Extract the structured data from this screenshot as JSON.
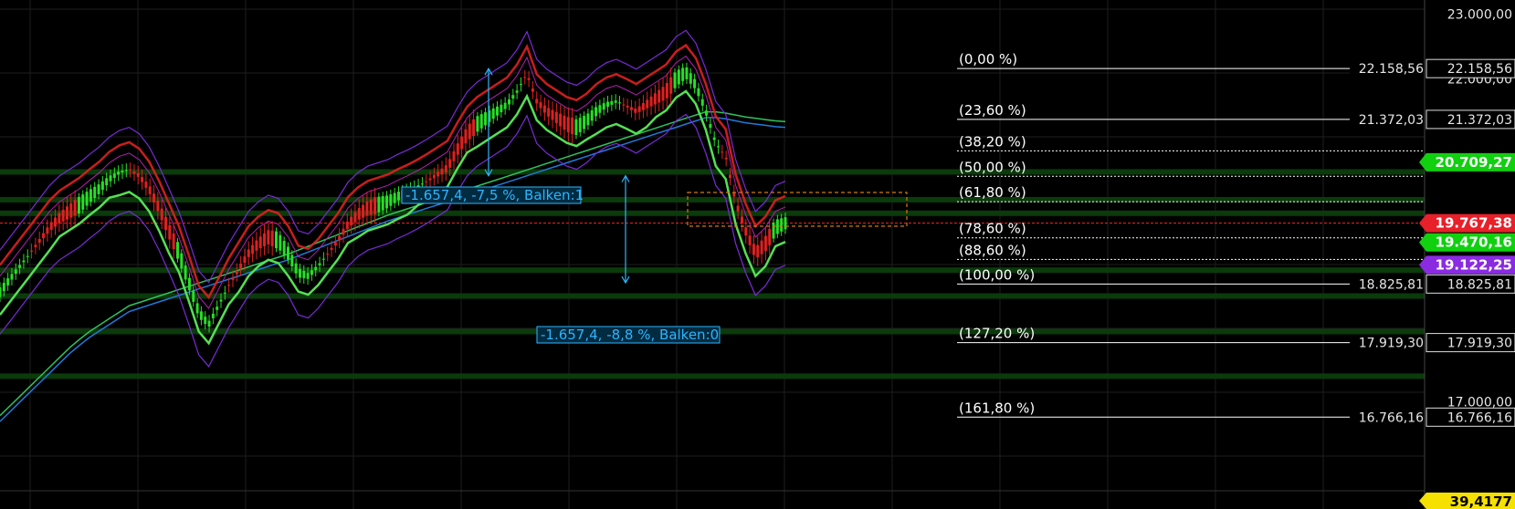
{
  "chart_data": {
    "type": "candlestick",
    "title": "",
    "ylim": [
      16700,
      23050
    ],
    "grid": true,
    "y_tick_labels": [
      "23.000,00",
      "22.000,00",
      "17.000,00"
    ],
    "fib_levels": [
      {
        "label": "(0,00 %)",
        "price_label": "22.158,56",
        "value": 22158.56
      },
      {
        "label": "(23,60 %)",
        "price_label": "21.372,03",
        "value": 21372.03
      },
      {
        "label": "(38,20 %)",
        "price_label": "",
        "value": 20885
      },
      {
        "label": "(50,00 %)",
        "price_label": "",
        "value": 20492
      },
      {
        "label": "(61,80 %)",
        "price_label": "",
        "value": 20099
      },
      {
        "label": "(78,60 %)",
        "price_label": "",
        "value": 19540
      },
      {
        "label": "(88,60 %)",
        "price_label": "",
        "value": 19207
      },
      {
        "label": "(100,00 %)",
        "price_label": "18.825,81",
        "value": 18825.81
      },
      {
        "label": "(127,20 %)",
        "price_label": "17.919,30",
        "value": 17919.3
      },
      {
        "label": "(161,80 %)",
        "price_label": "16.766,16",
        "value": 16766.16
      }
    ],
    "badges": [
      {
        "text": "20.709,27",
        "value": 20709.27,
        "color": "#10d010",
        "text_color": "#ffffff"
      },
      {
        "text": "19.767,38",
        "value": 19767.38,
        "color": "#e8202a",
        "text_color": "#ffffff"
      },
      {
        "text": "19.470,16",
        "value": 19470.16,
        "color": "#10d010",
        "text_color": "#ffffff"
      },
      {
        "text": "19.122,25",
        "value": 19122.25,
        "color": "#8a2be2",
        "text_color": "#ffffff"
      }
    ],
    "bottom_badge": {
      "text": "39,4177",
      "color": "#f5e000"
    },
    "measurements": [
      {
        "text": "-1.657,4, -7,5 %, Balken:1",
        "from": 22158.56,
        "to": 20501
      },
      {
        "text": "-1.657,4, -8,8 %, Balken:0",
        "from": 20501,
        "to": 18844
      }
    ],
    "ema_levels": [
      20560,
      20130,
      19920,
      19040,
      18640,
      18090,
      17400
    ],
    "current_price": 19767.38,
    "n_candles": 200,
    "series": [
      {
        "key": "close",
        "values": [
          18700,
          18900,
          19100,
          19300,
          19500,
          19700,
          19850,
          19950,
          20050,
          20180,
          20300,
          20450,
          20550,
          20600,
          20500,
          20300,
          20000,
          19650,
          19300,
          18850,
          18380,
          18200,
          18500,
          18800,
          19050,
          19300,
          19450,
          19550,
          19500,
          19300,
          19000,
          18950,
          19100,
          19300,
          19500,
          19750,
          19900,
          20000,
          20050,
          20100,
          20180,
          20250,
          20330,
          20420,
          20520,
          20620,
          20900,
          21150,
          21300,
          21400,
          21500,
          21600,
          21800,
          22080,
          21650,
          21500,
          21400,
          21300,
          21250,
          21350,
          21500,
          21600,
          21650,
          21580,
          21500,
          21600,
          21700,
          21800,
          22000,
          22100,
          21900,
          21500,
          21000,
          20800,
          20100,
          19650,
          19300,
          19450,
          19700,
          19767
        ]
      },
      {
        "key": "ema200",
        "values": [
          16700,
          16850,
          17000,
          17150,
          17300,
          17450,
          17600,
          17750,
          17880,
          18000,
          18100,
          18200,
          18300,
          18400,
          18450,
          18500,
          18550,
          18600,
          18650,
          18700,
          18750,
          18800,
          18850,
          18900,
          18950,
          19000,
          19050,
          19100,
          19150,
          19200,
          19260,
          19320,
          19380,
          19440,
          19500,
          19560,
          19620,
          19680,
          19740,
          19800,
          19850,
          19900,
          19950,
          20000,
          20050,
          20100,
          20150,
          20200,
          20250,
          20300,
          20350,
          20400,
          20450,
          20500,
          20550,
          20600,
          20650,
          20700,
          20750,
          20800,
          20850,
          20900,
          20950,
          21000,
          21050,
          21100,
          21150,
          21200,
          21250,
          21300,
          21350,
          21400,
          21400,
          21380,
          21350,
          21320,
          21300,
          21280,
          21260,
          21250
        ]
      }
    ]
  }
}
